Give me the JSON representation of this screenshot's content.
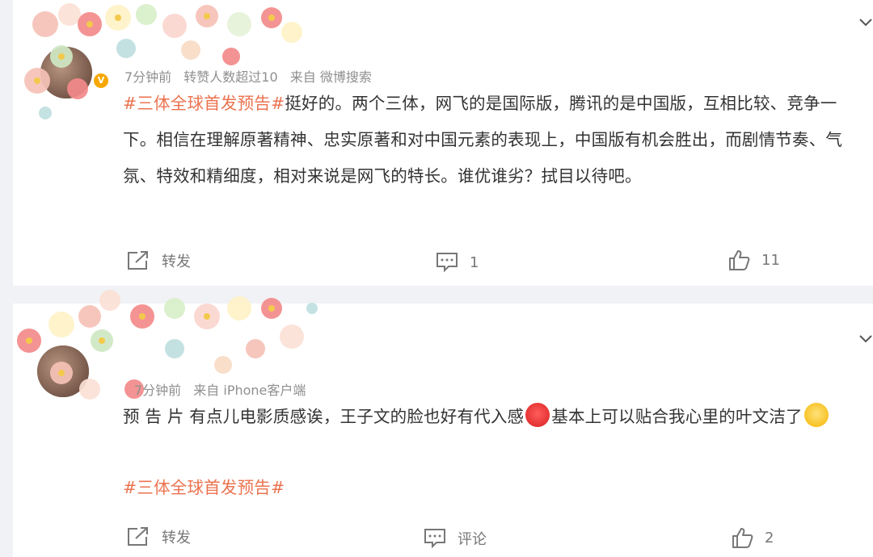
{
  "posts": [
    {
      "username": "",
      "time": "7分钟前",
      "reposts_note": "转赞人数超过10",
      "source": "来自 微博搜索",
      "topic": "#三体全球首发预告#",
      "text": "挺好的。两个三体，网飞的是国际版，腾讯的是中国版，互相比较、竞争一下。相信在理解原著精神、忠实原著和对中国元素的表现上，中国版有机会胜出，而剧情节奏、气氛、特效和精细度，相对来说是网飞的特长。谁优谁劣？拭目以待吧。",
      "actions": {
        "repost": "转发",
        "comment": "1",
        "like": "11"
      }
    },
    {
      "username": "",
      "time": "7分钟前",
      "source": "来自 iPhone客户端",
      "text_a": "预 告 片 有点儿电影质感诶，王子文的脸也好有代入感",
      "text_b": "基本上可以贴合我心里的叶文洁了",
      "topic": "#三体全球首发预告#",
      "actions": {
        "repost": "转发",
        "comment": "评论",
        "like": "2"
      }
    }
  ],
  "icons": {
    "emoji_1": "heart-eyes-emoji",
    "emoji_2": "smile-emoji",
    "verified": "verified-badge"
  },
  "colors": {
    "topic": "#eb7350",
    "meta": "#8f8f8f",
    "text": "#333333"
  }
}
